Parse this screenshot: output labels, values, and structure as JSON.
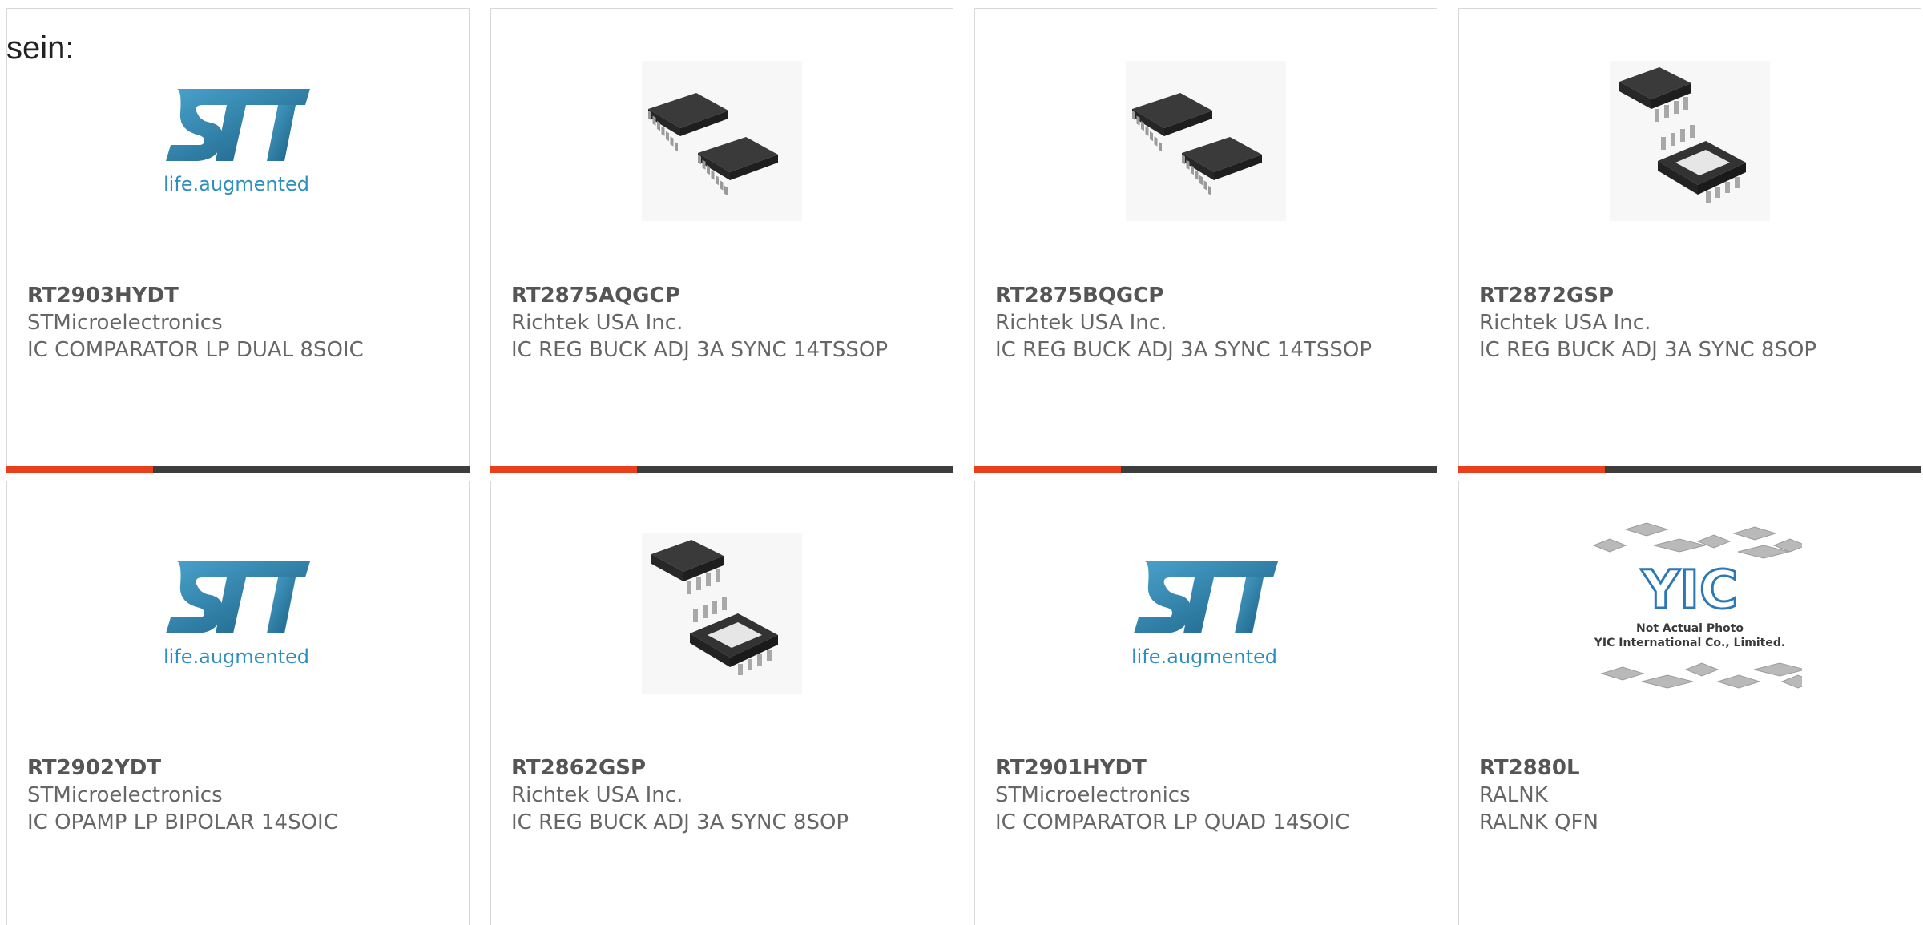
{
  "lead_text": "sein:",
  "colors": {
    "accent": "#e8401c",
    "bar_dark": "#3d3d3d",
    "st_blue": "#1d6f97",
    "st_text": "#2d8fbd"
  },
  "products": [
    {
      "part": "RT2903HYDT",
      "maker": "STMicroelectronics",
      "desc": "IC COMPARATOR LP DUAL 8SOIC",
      "image": "st-logo",
      "logo_text": "life.augmented"
    },
    {
      "part": "RT2875AQGCP",
      "maker": "Richtek USA Inc.",
      "desc": "IC REG BUCK ADJ 3A SYNC 14TSSOP",
      "image": "tssop-chip-icon"
    },
    {
      "part": "RT2875BQGCP",
      "maker": "Richtek USA Inc.",
      "desc": "IC REG BUCK ADJ 3A SYNC 14TSSOP",
      "image": "tssop-chip-icon"
    },
    {
      "part": "RT2872GSP",
      "maker": "Richtek USA Inc.",
      "desc": "IC REG BUCK ADJ 3A SYNC 8SOP",
      "image": "sop8-chip-icon"
    },
    {
      "part": "RT2902YDT",
      "maker": "STMicroelectronics",
      "desc": "IC OPAMP LP BIPOLAR 14SOIC",
      "image": "st-logo",
      "logo_text": "life.augmented"
    },
    {
      "part": "RT2862GSP",
      "maker": "Richtek USA Inc.",
      "desc": "IC REG BUCK ADJ 3A SYNC 8SOP",
      "image": "sop8-chip-icon"
    },
    {
      "part": "RT2901HYDT",
      "maker": "STMicroelectronics",
      "desc": "IC COMPARATOR LP QUAD 14SOIC",
      "image": "st-logo",
      "logo_text": "life.augmented"
    },
    {
      "part": "RT2880L",
      "maker": "RALNK",
      "desc": "RALNK QFN",
      "image": "yic-placeholder",
      "placeholder_lines": [
        "Not Actual Photo",
        "YIC International Co., Limited."
      ],
      "placeholder_logo": "YIC"
    }
  ]
}
